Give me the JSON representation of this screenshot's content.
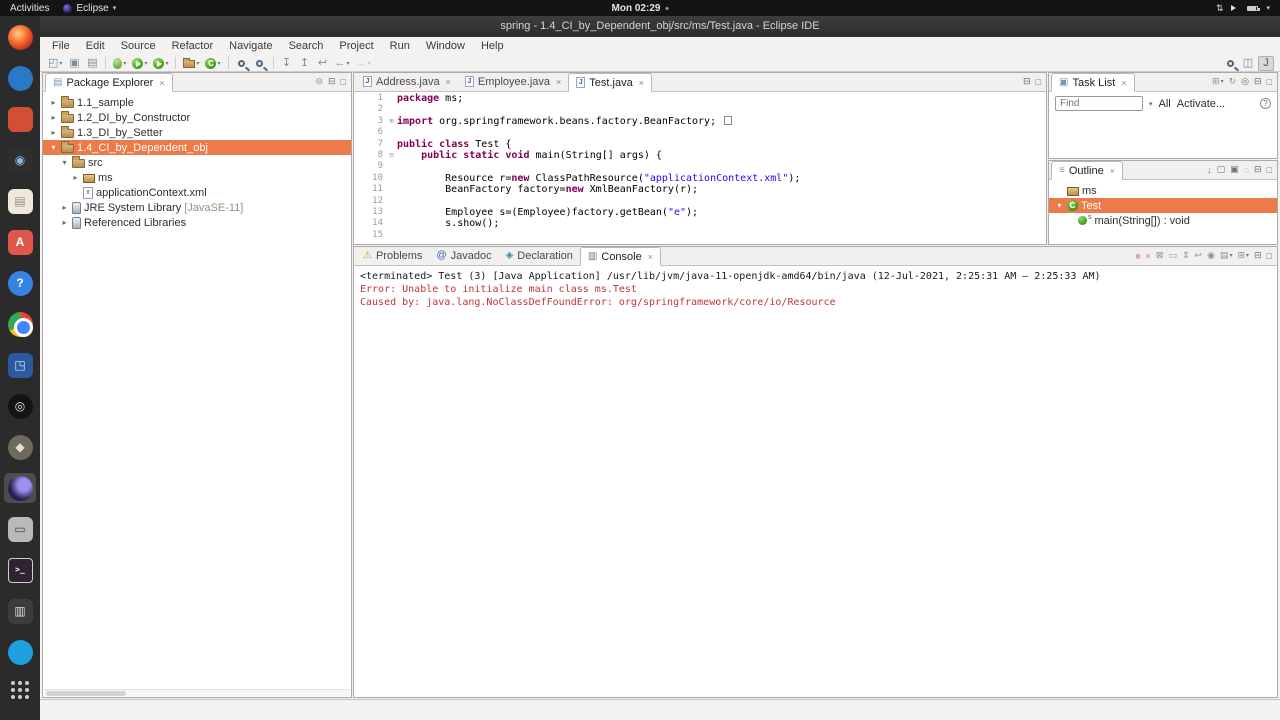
{
  "icons": {
    "close": "×",
    "caret": "▾",
    "updown": "⇅",
    "java_badge": "J"
  },
  "topbar": {
    "activities_label": "Activities",
    "app_name": "Eclipse",
    "clock": "Mon 02:29"
  },
  "window_title": "spring - 1.4_CI_by_Dependent_obj/src/ms/Test.java - Eclipse IDE",
  "menubar": [
    "File",
    "Edit",
    "Source",
    "Refactor",
    "Navigate",
    "Search",
    "Project",
    "Run",
    "Window",
    "Help"
  ],
  "main_toolbar": [
    {
      "name": "new-wizard-icon",
      "kind": "glyph",
      "glyph": "◰",
      "color": "#6b87a8",
      "dropdown": true
    },
    {
      "name": "save-icon",
      "kind": "glyph",
      "glyph": "▣",
      "color": "#7d8da0"
    },
    {
      "name": "print-icon",
      "kind": "glyph",
      "glyph": "▤",
      "color": "#7d8da0"
    },
    {
      "sep": true
    },
    {
      "name": "debug-icon",
      "kind": "bug",
      "dropdown": true
    },
    {
      "name": "run-icon",
      "kind": "run",
      "dropdown": true
    },
    {
      "name": "external-tools-icon",
      "kind": "run",
      "dropdown": true
    },
    {
      "sep": true
    },
    {
      "name": "new-java-project-icon",
      "kind": "folder",
      "dropdown": true
    },
    {
      "name": "new-class-icon",
      "kind": "class",
      "dropdown": true
    },
    {
      "sep": true
    },
    {
      "name": "open-type-icon",
      "kind": "magnifier"
    },
    {
      "name": "search-icon",
      "kind": "magnifier"
    },
    {
      "sep": true
    },
    {
      "name": "next-annotation-icon",
      "kind": "glyph",
      "glyph": "↧",
      "color": "#888888"
    },
    {
      "name": "previous-annotation-icon",
      "kind": "glyph",
      "glyph": "↥",
      "color": "#888888"
    },
    {
      "name": "last-edit-location-icon",
      "kind": "glyph",
      "glyph": "↩",
      "color": "#888888"
    },
    {
      "name": "back-icon",
      "kind": "glyph",
      "glyph": "←",
      "color": "#888888",
      "dropdown": true
    },
    {
      "name": "forward-icon",
      "kind": "glyph",
      "glyph": "→",
      "color": "#888888",
      "dropdown": true,
      "disabled": true
    }
  ],
  "toolbar_right": [
    {
      "name": "quick-search-icon",
      "kind": "magnifier"
    },
    {
      "name": "open-perspective-icon",
      "kind": "glyph",
      "glyph": "◫",
      "color": "#6b87a8"
    },
    {
      "name": "java-perspective-icon",
      "kind": "glyph",
      "glyph": "J",
      "color": "#2a5db0",
      "pressed": true
    }
  ],
  "dock_items": [
    {
      "name": "dock-firefox-icon",
      "kind": "firefox"
    },
    {
      "name": "dock-thunderbird-icon",
      "kind": "plain",
      "circle": true,
      "bg": "#2a78c8",
      "fg": "#ffffff",
      "glyph": ""
    },
    {
      "name": "dock-app-icon-1",
      "kind": "plain",
      "bg": "#d14f35",
      "fg": "#ffffff",
      "glyph": ""
    },
    {
      "name": "dock-camera-icon",
      "kind": "plain",
      "bg": "#2f2f2f",
      "fg": "#8fb8e0",
      "glyph": "◉"
    },
    {
      "name": "dock-files-icon",
      "kind": "plain",
      "bg": "#efe9dc",
      "fg": "#9a917e",
      "glyph": "▤"
    },
    {
      "name": "dock-software-icon",
      "kind": "plain",
      "bg": "#e0574a",
      "fg": "#ffffff",
      "glyph": "A"
    },
    {
      "name": "dock-help-icon",
      "kind": "plain",
      "circle": true,
      "bg": "#3584e4",
      "fg": "#ffffff",
      "glyph": "?"
    },
    {
      "name": "dock-chrome-icon",
      "kind": "chrome"
    },
    {
      "name": "dock-app-icon-2",
      "kind": "plain",
      "bg": "#2c5aa0",
      "fg": "#cfe2ff",
      "glyph": "◳"
    },
    {
      "name": "dock-obs-icon",
      "kind": "plain",
      "circle": true,
      "bg": "#141414",
      "fg": "#e8e8e8",
      "glyph": "◎"
    },
    {
      "name": "dock-app-icon-3",
      "kind": "plain",
      "circle": true,
      "bg": "#6f6a5e",
      "fg": "#e8e0d0",
      "glyph": "◆"
    },
    {
      "name": "dock-eclipse-icon",
      "kind": "eclipse",
      "active": true
    },
    {
      "name": "dock-printer-icon",
      "kind": "plain",
      "bg": "#b9b9b9",
      "fg": "#4a4a4a",
      "glyph": "▭"
    },
    {
      "name": "dock-terminal-icon",
      "kind": "terminal",
      "glyph": ">_"
    },
    {
      "name": "dock-video-editor-icon",
      "kind": "plain",
      "bg": "#3c3c3c",
      "fg": "#dddddd",
      "glyph": "▥"
    },
    {
      "name": "dock-app-icon-4",
      "kind": "plain",
      "circle": true,
      "bg": "#1d9fe0",
      "fg": "#ffffff",
      "glyph": ""
    },
    {
      "name": "dock-show-apps-icon",
      "kind": "grid"
    }
  ],
  "package_explorer": {
    "title": "Package Explorer",
    "tab_glyph": "▤",
    "header_icons": [
      {
        "name": "collapse-all-icon",
        "glyph": "⊖",
        "color": "#7d93ab"
      },
      {
        "name": "minimize-icon",
        "glyph": "⊟",
        "color": "#6f6f6f"
      },
      {
        "name": "maximize-icon",
        "glyph": "□",
        "color": "#6f6f6f"
      }
    ],
    "tree": [
      {
        "label": "1.1_sample",
        "icon": "project",
        "arrow": "collapsed",
        "depth": 0
      },
      {
        "label": "1.2_DI_by_Constructor",
        "icon": "project",
        "arrow": "collapsed",
        "depth": 0
      },
      {
        "label": "1.3_DI_by_Setter",
        "icon": "project",
        "arrow": "collapsed",
        "depth": 0
      },
      {
        "label": "1.4_CI_by_Dependent_obj",
        "icon": "project",
        "arrow": "expanded",
        "depth": 0,
        "selected": true
      },
      {
        "label": "src",
        "icon": "src-folder",
        "arrow": "expanded",
        "depth": 1
      },
      {
        "label": "ms",
        "icon": "package",
        "arrow": "collapsed",
        "depth": 2
      },
      {
        "label": "applicationContext.xml",
        "icon": "xml-file",
        "icon_badge": "x",
        "arrow": "none",
        "depth": 2
      },
      {
        "label": "JRE System Library",
        "decoration": " [JavaSE-11]",
        "icon": "library",
        "arrow": "collapsed",
        "depth": 1
      },
      {
        "label": "Referenced Libraries",
        "icon": "library",
        "arrow": "collapsed",
        "depth": 1
      }
    ]
  },
  "editor": {
    "tabs": [
      {
        "label": "Address.java"
      },
      {
        "label": "Employee.java"
      },
      {
        "label": "Test.java",
        "active": true
      }
    ],
    "header_icons": [
      {
        "name": "minimize-icon",
        "glyph": "⊟",
        "color": "#6f6f6f"
      },
      {
        "name": "maximize-icon",
        "glyph": "□",
        "color": "#6f6f6f"
      }
    ],
    "code": [
      {
        "no": "1",
        "fold": "",
        "tokens": [
          [
            "kw",
            "package"
          ],
          [
            "pl",
            " ms;"
          ]
        ]
      },
      {
        "no": "2",
        "fold": "",
        "tokens": []
      },
      {
        "no": "3",
        "fold": "+",
        "tokens": [
          [
            "kw",
            "import"
          ],
          [
            "pl",
            " org.springframework.beans.factory.BeanFactory; "
          ],
          [
            "box",
            ""
          ]
        ]
      },
      {
        "no": "6",
        "fold": "",
        "tokens": []
      },
      {
        "no": "7",
        "fold": "",
        "tokens": [
          [
            "kw",
            "public"
          ],
          [
            "pl",
            " "
          ],
          [
            "kw",
            "class"
          ],
          [
            "pl",
            " Test {"
          ]
        ]
      },
      {
        "no": "8",
        "fold": "-",
        "tokens": [
          [
            "pl",
            "    "
          ],
          [
            "kw",
            "public"
          ],
          [
            "pl",
            " "
          ],
          [
            "kw",
            "static"
          ],
          [
            "pl",
            " "
          ],
          [
            "kw",
            "void"
          ],
          [
            "pl",
            " main(String[] args) {"
          ]
        ]
      },
      {
        "no": "9",
        "fold": "",
        "tokens": []
      },
      {
        "no": "10",
        "fold": "",
        "tokens": [
          [
            "pl",
            "        Resource r="
          ],
          [
            "kw",
            "new"
          ],
          [
            "pl",
            " ClassPathResource("
          ],
          [
            "str",
            "\"applicationContext.xml\""
          ],
          [
            "pl",
            ");"
          ]
        ]
      },
      {
        "no": "11",
        "fold": "",
        "tokens": [
          [
            "pl",
            "        BeanFactory factory="
          ],
          [
            "kw",
            "new"
          ],
          [
            "pl",
            " XmlBeanFactory(r);"
          ]
        ]
      },
      {
        "no": "12",
        "fold": "",
        "tokens": []
      },
      {
        "no": "13",
        "fold": "",
        "tokens": [
          [
            "pl",
            "        Employee s=(Employee)factory.getBean("
          ],
          [
            "str",
            "\"e\""
          ],
          [
            "pl",
            ");"
          ]
        ]
      },
      {
        "no": "14",
        "fold": "",
        "tokens": [
          [
            "pl",
            "        s.show();"
          ]
        ]
      },
      {
        "no": "15",
        "fold": "",
        "tokens": []
      }
    ]
  },
  "task_list": {
    "title": "Task List",
    "tab_glyph": "▣",
    "header_icons": [
      {
        "name": "new-task-icon",
        "glyph": "⊞",
        "color": "#7d93ab",
        "dropdown": true
      },
      {
        "name": "sync-icon",
        "glyph": "↻",
        "color": "#7d93ab"
      },
      {
        "name": "focus-icon",
        "glyph": "◎",
        "color": "#6f6f6f"
      },
      {
        "name": "minimize-icon",
        "glyph": "⊟",
        "color": "#6f6f6f"
      },
      {
        "name": "maximize-icon",
        "glyph": "□",
        "color": "#6f6f6f"
      }
    ],
    "find_placeholder": "Find",
    "scope_label": "All",
    "activate_label": "Activate...",
    "help_label": "?"
  },
  "outline": {
    "title": "Outline",
    "tab_glyph": "≡",
    "header_icons": [
      {
        "name": "sort-icon",
        "glyph": "↓",
        "color": "#6f6f6f"
      },
      {
        "name": "hide-fields-icon",
        "glyph": "▢",
        "color": "#6f6f6f"
      },
      {
        "name": "hide-static-members-icon",
        "glyph": "▣",
        "color": "#6f6f6f"
      },
      {
        "name": "hide-non-public-icon",
        "glyph": "◌",
        "color": "#6f6f6f"
      },
      {
        "name": "minimize-icon",
        "glyph": "⊟",
        "color": "#6f6f6f"
      },
      {
        "name": "maximize-icon",
        "glyph": "□",
        "color": "#6f6f6f"
      }
    ],
    "items": [
      {
        "label": "ms",
        "icon": "package",
        "arrow": "none",
        "depth": 0
      },
      {
        "label": "Test",
        "icon": "class",
        "icon_badge": "C",
        "arrow": "expanded",
        "depth": 0,
        "selected": true
      },
      {
        "label": "main(String[]) : void",
        "icon": "method",
        "arrow": "none",
        "depth": 1,
        "static": true
      }
    ]
  },
  "bottom_panel": {
    "tabs": [
      {
        "name": "tab-problems",
        "label": "Problems",
        "glyph": "⚠",
        "glyph_color": "#c9a227"
      },
      {
        "name": "tab-javadoc",
        "label": "Javadoc",
        "glyph": "@",
        "glyph_color": "#2a5db0"
      },
      {
        "name": "tab-declaration",
        "label": "Declaration",
        "glyph": "◈",
        "glyph_color": "#3a8ca8"
      },
      {
        "name": "tab-console",
        "label": "Console",
        "glyph": "▥",
        "glyph_color": "#5a7ca0",
        "active": true,
        "closable": true
      }
    ],
    "toolbar_icons": [
      {
        "name": "terminate-icon",
        "glyph": "■",
        "color": "#dcaaaa"
      },
      {
        "name": "remove-launch-icon",
        "glyph": "×",
        "color": "#8f8f8f"
      },
      {
        "name": "remove-all-launches-icon",
        "glyph": "⊠",
        "color": "#8f8f8f"
      },
      {
        "name": "clear-console-icon",
        "glyph": "▭",
        "color": "#7d93ab"
      },
      {
        "name": "scroll-lock-icon",
        "glyph": "⇕",
        "color": "#8f8f8f"
      },
      {
        "name": "word-wrap-icon",
        "glyph": "↩",
        "color": "#8f8f8f"
      },
      {
        "name": "pin-console-icon",
        "glyph": "◉",
        "color": "#8f8f8f"
      },
      {
        "name": "display-selected-console-icon",
        "glyph": "▤",
        "color": "#7d93ab",
        "dropdown": true
      },
      {
        "name": "open-console-icon",
        "glyph": "⊞",
        "color": "#7d93ab",
        "dropdown": true
      },
      {
        "name": "minimize-icon",
        "glyph": "⊟",
        "color": "#6f6f6f"
      },
      {
        "name": "maximize-icon",
        "glyph": "□",
        "color": "#6f6f6f"
      }
    ],
    "console_lines": [
      {
        "kind": "meta",
        "text": "<terminated> Test (3) [Java Application] /usr/lib/jvm/java-11-openjdk-amd64/bin/java (12-Jul-2021, 2:25:31 AM – 2:25:33 AM)"
      },
      {
        "kind": "error",
        "text": "Error: Unable to initialize main class ms.Test"
      },
      {
        "kind": "error",
        "text": "Caused by: java.lang.NoClassDefFoundError: org/springframework/core/io/Resource"
      }
    ]
  }
}
